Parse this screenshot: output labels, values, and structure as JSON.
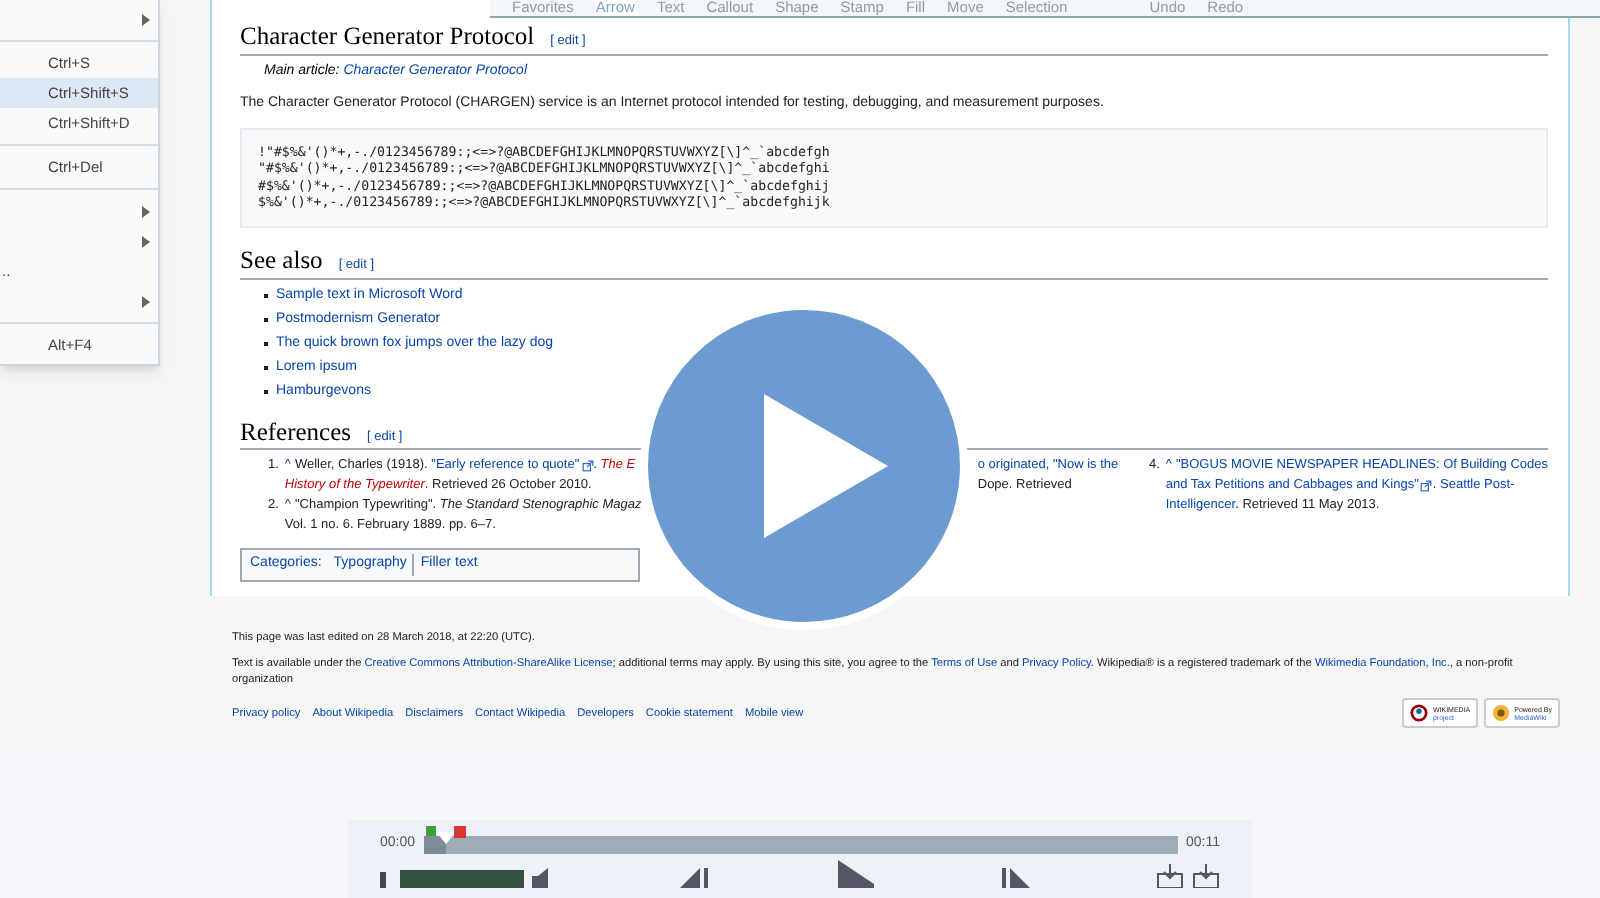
{
  "toolbar": {
    "items": [
      {
        "label": "Favorites",
        "selected": false
      },
      {
        "label": "Arrow",
        "selected": true
      },
      {
        "label": "Text",
        "selected": false
      },
      {
        "label": "Callout",
        "selected": false
      },
      {
        "label": "Shape",
        "selected": false
      },
      {
        "label": "Stamp",
        "selected": false
      },
      {
        "label": "Fill",
        "selected": false
      },
      {
        "label": "Move",
        "selected": false
      },
      {
        "label": "Selection",
        "selected": false
      },
      {
        "label": "Undo",
        "selected": false
      },
      {
        "label": "Redo",
        "selected": false
      }
    ]
  },
  "menu": {
    "items": [
      {
        "kind": "submenu",
        "selected": false
      },
      {
        "kind": "separator"
      },
      {
        "kind": "shortcut",
        "text": "Ctrl+S",
        "selected": false
      },
      {
        "kind": "shortcut",
        "text": "Ctrl+Shift+S",
        "selected": true
      },
      {
        "kind": "shortcut",
        "text": "Ctrl+Shift+D",
        "selected": false
      },
      {
        "kind": "separator"
      },
      {
        "kind": "shortcut",
        "text": "Ctrl+Del",
        "selected": false
      },
      {
        "kind": "separator"
      },
      {
        "kind": "submenu",
        "selected": false
      },
      {
        "kind": "submenu",
        "selected": false
      },
      {
        "kind": "label",
        "text": "..",
        "selected": false
      },
      {
        "kind": "submenu",
        "selected": false
      },
      {
        "kind": "separator"
      },
      {
        "kind": "shortcut",
        "text": "Alt+F4",
        "selected": false
      }
    ]
  },
  "article": {
    "heading": "Character Generator Protocol",
    "edit": "[ edit ]",
    "hatnote": {
      "prefix": "Main article: ",
      "link": "Character Generator Protocol"
    },
    "intro": "The Character Generator Protocol (CHARGEN) service is an Internet protocol intended for testing, debugging, and measurement purposes.",
    "code_lines": [
      "!\"#$%&'()*+,-./0123456789:;<=>?@ABCDEFGHIJKLMNOPQRSTUVWXYZ[\\]^_`abcdefgh",
      "\"#$%&'()*+,-./0123456789:;<=>?@ABCDEFGHIJKLMNOPQRSTUVWXYZ[\\]^_`abcdefghi",
      "#$%&'()*+,-./0123456789:;<=>?@ABCDEFGHIJKLMNOPQRSTUVWXYZ[\\]^_`abcdefghij",
      "$%&'()*+,-./0123456789:;<=>?@ABCDEFGHIJKLMNOPQRSTUVWXYZ[\\]^_`abcdefghijk"
    ],
    "see_also": {
      "heading": "See also",
      "edit": "[ edit ]",
      "items": [
        "Sample text in Microsoft Word",
        "Postmodernism Generator",
        "The quick brown fox jumps over the lazy dog",
        "Lorem ipsum",
        "Hamburgevons"
      ]
    },
    "references": {
      "heading": "References",
      "edit": "[ edit ]",
      "columns": [
        [
          {
            "number": "1.",
            "caret": "^",
            "segments": [
              {
                "kind": "plain",
                "text": "Weller, Charles (1918). "
              },
              {
                "kind": "link",
                "text": "\"Early reference to quote\"",
                "external": true
              },
              {
                "kind": "plain",
                "text": ". "
              },
              {
                "kind": "redlink",
                "text": "The E"
              },
              {
                "kind": "break"
              },
              {
                "kind": "redlink",
                "text": "History of the Typewriter"
              },
              {
                "kind": "plain",
                "text": ". Retrieved 26 October 2010."
              }
            ]
          },
          {
            "number": "2.",
            "caret": "^",
            "segments": [
              {
                "kind": "plain",
                "text": "\"Champion Typewriting\". "
              },
              {
                "kind": "italic",
                "text": "The Standard Stenographic Magaz"
              },
              {
                "kind": "break"
              },
              {
                "kind": "plain",
                "text": "Vol. 1 no. 6. February 1889. pp. 6–7."
              }
            ]
          }
        ],
        [
          {
            "segments": [
              {
                "kind": "link",
                "text": "o originated, \"Now is the",
                "external": false
              },
              {
                "kind": "break"
              },
              {
                "kind": "plain",
                "text": "Dope. Retrieved"
              }
            ]
          }
        ],
        [
          {
            "number": "4.",
            "caret": "^",
            "segments": [
              {
                "kind": "link",
                "text": "\"BOGUS MOVIE NEWSPAPER HEADLINES: Of Building Codes",
                "external": false
              },
              {
                "kind": "break"
              },
              {
                "kind": "link",
                "text": "and Tax Petitions and Cabbages and Kings\"",
                "external": true
              },
              {
                "kind": "plain",
                "text": ". "
              },
              {
                "kind": "link",
                "text": "Seattle Post-",
                "external": false
              },
              {
                "kind": "break"
              },
              {
                "kind": "link",
                "text": "Intelligencer",
                "external": false
              },
              {
                "kind": "plain",
                "text": ". Retrieved 11 May 2013."
              }
            ]
          }
        ]
      ]
    },
    "categories": {
      "label": "Categories:",
      "items": [
        "Typography",
        "Filler text"
      ]
    }
  },
  "footer": {
    "last_edited": "This page was last edited on 28 March 2018, at 22:20 (UTC).",
    "license": [
      {
        "kind": "plain",
        "text": "Text is available under the "
      },
      {
        "kind": "link",
        "text": "Creative Commons Attribution-ShareAlike License"
      },
      {
        "kind": "plain",
        "text": "; additional terms may apply. By using this site, you agree to the "
      },
      {
        "kind": "link",
        "text": "Terms of Use"
      },
      {
        "kind": "plain",
        "text": " and "
      },
      {
        "kind": "link",
        "text": "Privacy Policy"
      },
      {
        "kind": "plain",
        "text": ". Wikipedia® is a registered trademark of the "
      },
      {
        "kind": "link",
        "text": "Wikimedia Foundation, Inc."
      },
      {
        "kind": "plain",
        "text": ", a non-profit organization"
      }
    ],
    "links": [
      "Privacy policy",
      "About Wikipedia",
      "Disclaimers",
      "Contact Wikipedia",
      "Developers",
      "Cookie statement",
      "Mobile view"
    ],
    "badges": [
      {
        "kind": "wikimedia",
        "line1": "WIKIMEDIA",
        "line2": "project"
      },
      {
        "kind": "mediawiki",
        "line1": "Powered By",
        "line2": "MediaWiki"
      }
    ]
  },
  "player": {
    "current_time": "00:00",
    "total_time": "00:11",
    "level": 0.03
  }
}
